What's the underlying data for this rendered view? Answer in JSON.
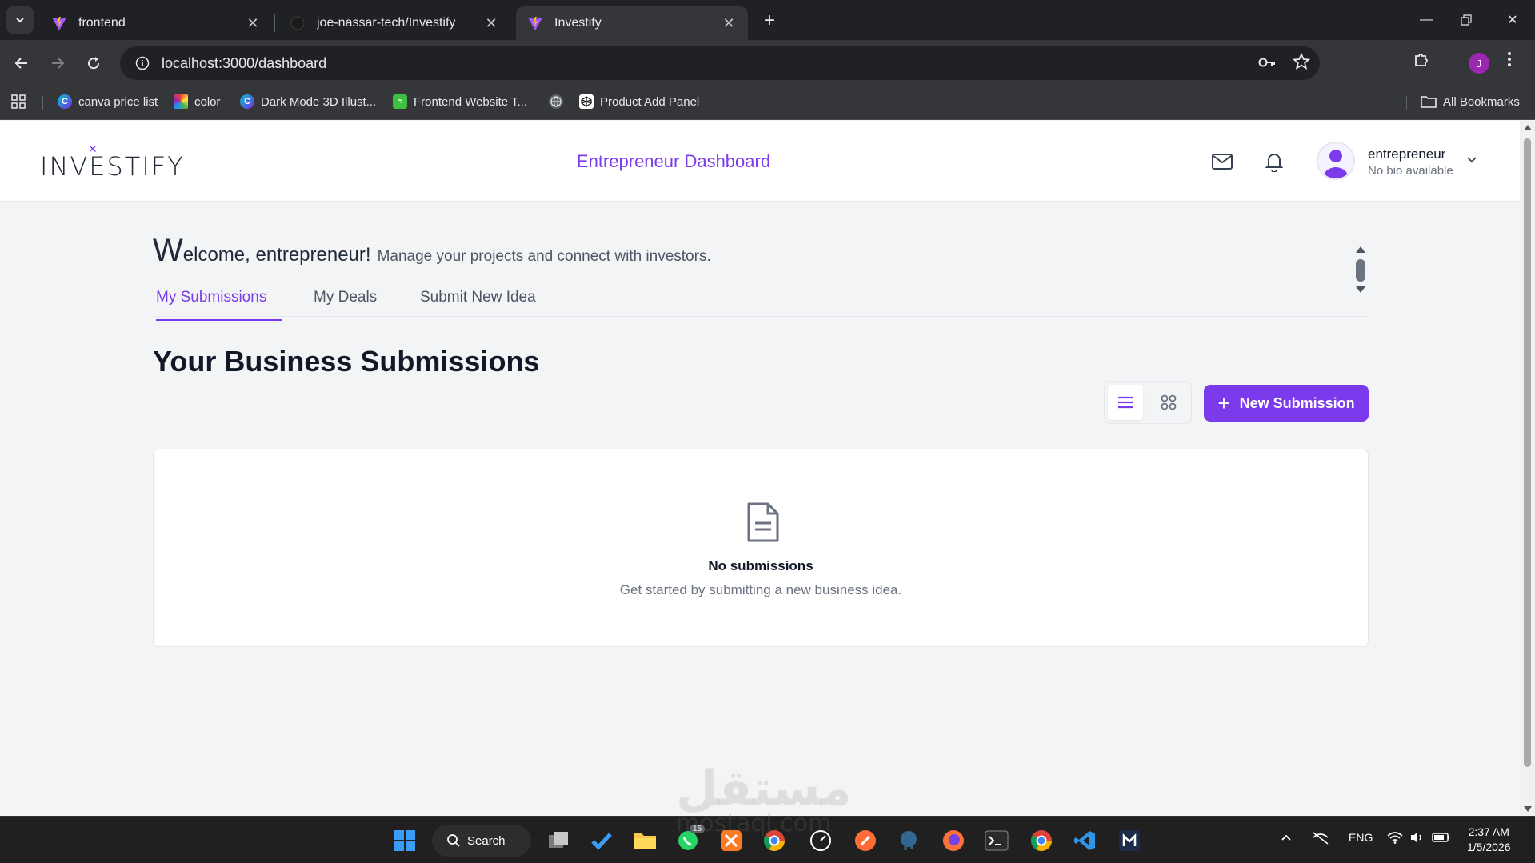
{
  "browser": {
    "tabs": [
      {
        "title": "frontend",
        "icon": "vite-icon",
        "active": false
      },
      {
        "title": "joe-nassar-tech/Investify",
        "icon": "github-icon",
        "active": false
      },
      {
        "title": "Investify",
        "icon": "vite-icon",
        "active": true
      }
    ],
    "url": "localhost:3000/dashboard",
    "profile_initial": "J",
    "bookmarks": [
      {
        "label": "canva price list",
        "icon": "canva-icon"
      },
      {
        "label": "color",
        "icon": "color-icon"
      },
      {
        "label": "Dark Mode 3D Illust...",
        "icon": "canva-icon"
      },
      {
        "label": "Frontend Website T...",
        "icon": "frontend-icon"
      },
      {
        "label": "",
        "icon": "globe-icon"
      },
      {
        "label": "Product Add Panel",
        "icon": "codepen-icon"
      }
    ],
    "all_bookmarks": "All Bookmarks"
  },
  "header": {
    "logo": "INVESTIFY",
    "title": "Entrepreneur Dashboard",
    "user_name": "entrepreneur",
    "user_bio": "No bio available"
  },
  "welcome": {
    "cap": "W",
    "heading_rest": "elcome, entrepreneur!",
    "subtitle": "Manage your projects and connect with investors."
  },
  "tabs": [
    {
      "label": "My Submissions",
      "active": true
    },
    {
      "label": "My Deals",
      "active": false
    },
    {
      "label": "Submit New Idea",
      "active": false
    }
  ],
  "submissions": {
    "title": "Your Business Submissions",
    "new_button": "New Submission",
    "empty_title": "No submissions",
    "empty_subtitle": "Get started by submitting a new business idea."
  },
  "watermark": {
    "text": "مستقل",
    "sub": "mostaql.com"
  },
  "taskbar": {
    "search_label": "Search",
    "whatsapp_badge": "15",
    "lang": "ENG",
    "time": "2:37 AM",
    "date": "1/5/2026"
  },
  "colors": {
    "accent": "#7c3aed",
    "chrome_dark": "#202124",
    "chrome_toolbar": "#35363a"
  }
}
